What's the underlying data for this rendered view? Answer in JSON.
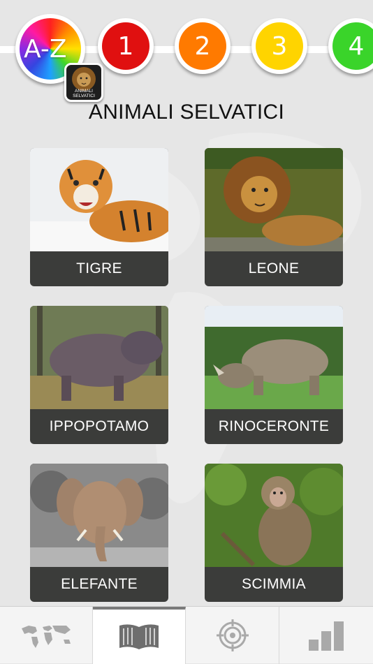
{
  "levels": [
    {
      "label": "A-Z",
      "badge_caption": "ANIMALI SELVATICI",
      "icon": "rainbow-az-icon"
    },
    {
      "label": "1",
      "color": "#e01010"
    },
    {
      "label": "2",
      "color": "#ff7a00"
    },
    {
      "label": "3",
      "color": "#ffd400"
    },
    {
      "label": "4",
      "color": "#3ad42a"
    }
  ],
  "page_title": "ANIMALI SELVATICI",
  "animals": [
    {
      "label": "TIGRE",
      "icon": "tiger-photo"
    },
    {
      "label": "LEONE",
      "icon": "lion-photo"
    },
    {
      "label": "IPPOPOTAMO",
      "icon": "hippo-photo"
    },
    {
      "label": "RINOCERONTE",
      "icon": "rhino-photo"
    },
    {
      "label": "ELEFANTE",
      "icon": "elephant-photo"
    },
    {
      "label": "SCIMMIA",
      "icon": "monkey-photo"
    }
  ],
  "tabs": [
    {
      "icon": "world-map-icon",
      "active": false
    },
    {
      "icon": "open-book-icon",
      "active": true
    },
    {
      "icon": "target-icon",
      "active": false
    },
    {
      "icon": "bar-chart-icon",
      "active": false
    }
  ],
  "colors": {
    "card_label_bg": "#3b3c3a",
    "background": "#e6e6e6"
  }
}
